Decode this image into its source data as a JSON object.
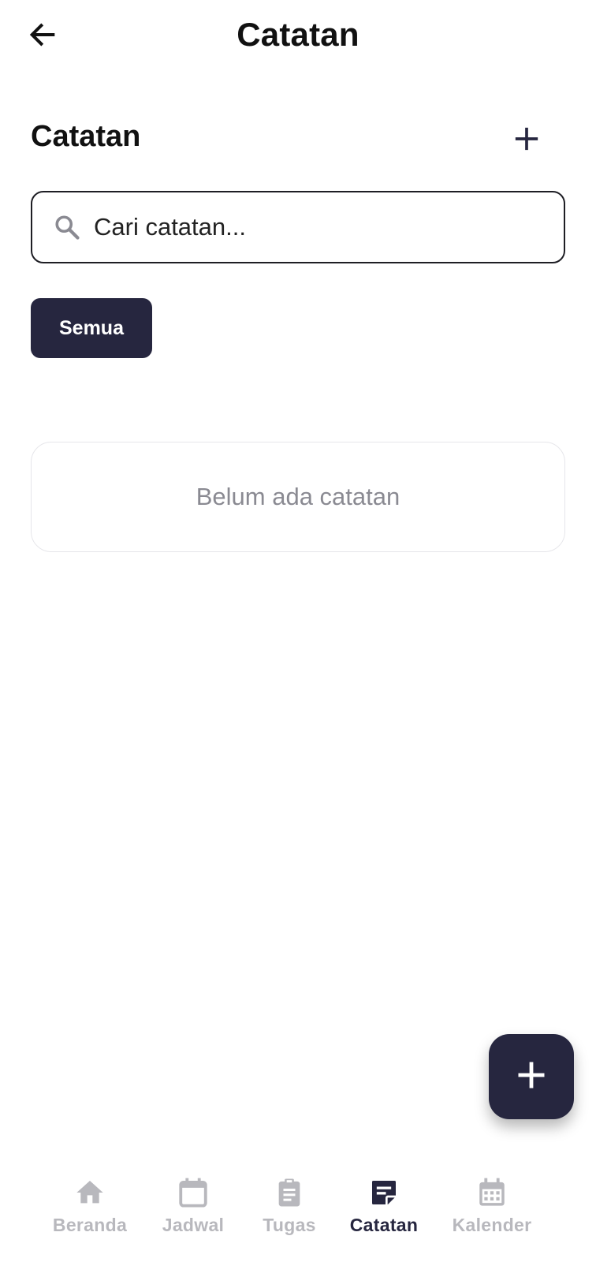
{
  "appbar": {
    "title": "Catatan",
    "back_icon": "arrow-left-icon"
  },
  "section": {
    "title": "Catatan",
    "add_icon": "plus-icon"
  },
  "search": {
    "placeholder": "Cari catatan...",
    "value": "",
    "icon": "search-icon"
  },
  "filters": {
    "active_label": "Semua"
  },
  "empty_state": {
    "message": "Belum ada catatan"
  },
  "fab": {
    "icon": "plus-icon"
  },
  "bottom_nav": {
    "items": [
      {
        "label": "Beranda",
        "icon": "home-icon",
        "active": false
      },
      {
        "label": "Jadwal",
        "icon": "calendar-icon",
        "active": false
      },
      {
        "label": "Tugas",
        "icon": "clipboard-icon",
        "active": false
      },
      {
        "label": "Catatan",
        "icon": "note-icon",
        "active": true
      },
      {
        "label": "Kalender",
        "icon": "calendar-grid-icon",
        "active": false
      }
    ]
  },
  "colors": {
    "primary": "#26263f",
    "inactive": "#b8b8bd",
    "muted_text": "#8a8a92",
    "border": "#e6e6ea"
  }
}
